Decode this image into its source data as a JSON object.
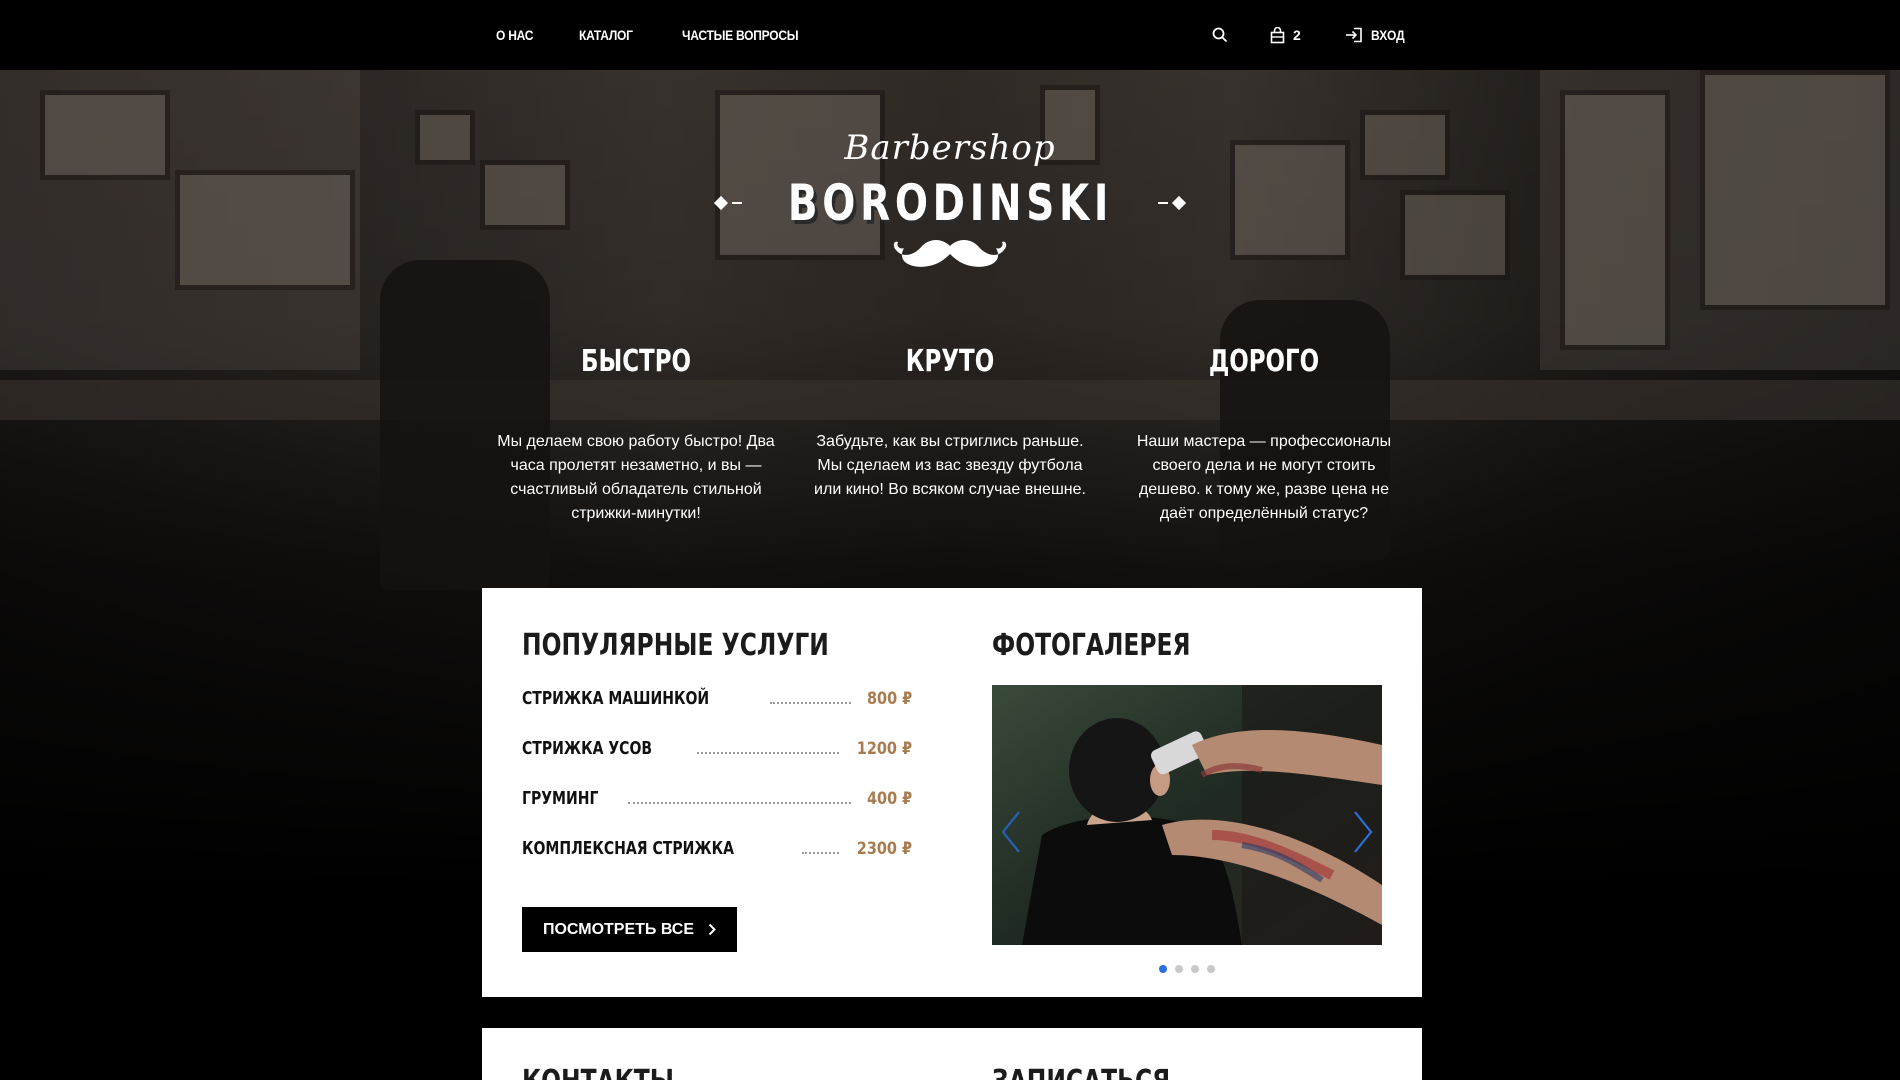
{
  "nav": {
    "items": [
      "О НАС",
      "КАТАЛОГ",
      "ЧАСТЫЕ ВОПРОСЫ"
    ]
  },
  "user_bar": {
    "search_icon": "search-icon",
    "cart_icon": "basket-icon",
    "cart_count": "2",
    "login_icon": "login-icon",
    "login_label": "ВХОД"
  },
  "logo": {
    "script": "Barbershop",
    "name": "BORODINSKI",
    "icon": "mustache-icon"
  },
  "features": [
    {
      "title": "БЫСТРО",
      "text": "Мы делаем свою работу быстро! Два часа пролетят незаметно, и вы — счастливый обладатель стильной стрижки-минутки!"
    },
    {
      "title": "КРУТО",
      "text": "Забудьте, как вы стриглись раньше. Мы сделаем из вас звезду футбола или кино! Во всяком случае внешне."
    },
    {
      "title": "ДОРОГО",
      "text": "Наши мастера — профессионалы своего дела и не могут стоить дешево. к тому же, разве цена не даёт определённый статус?"
    }
  ],
  "services": {
    "title": "ПОПУЛЯРНЫЕ УСЛУГИ",
    "items": [
      {
        "name": "СТРИЖКА МАШИНКОЙ",
        "price": "800 ₽"
      },
      {
        "name": "СТРИЖКА УСОВ",
        "price": "1200 ₽"
      },
      {
        "name": "ГРУМИНГ",
        "price": "400 ₽"
      },
      {
        "name": "КОМПЛЕКСНАЯ СТРИЖКА",
        "price": "2300 ₽"
      }
    ],
    "button_label": "ПОСМОТРЕТЬ ВСЕ"
  },
  "gallery": {
    "title": "ФОТОГАЛЕРЕЯ",
    "slides_total": 4,
    "active_slide": 1
  },
  "bottom": {
    "contacts_title": "КОНТАКТЫ",
    "signup_title": "ЗАПИСАТЬСЯ"
  },
  "colors": {
    "accent_price": "#a87c4f",
    "slider_active": "#2a6fdb",
    "header_bg": "#000000"
  }
}
